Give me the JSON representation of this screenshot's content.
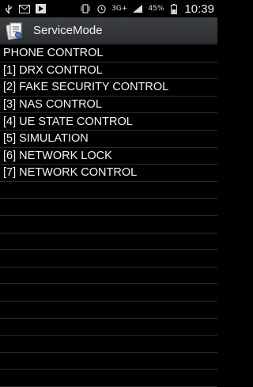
{
  "status_bar": {
    "notification_icons": [
      "usb-icon",
      "email-icon",
      "play-store-icon"
    ],
    "network_type": "3G+",
    "battery_percent": "45%",
    "time": "10:39"
  },
  "action_bar": {
    "title": "ServiceMode"
  },
  "menu": {
    "items": [
      "PHONE CONTROL",
      "[1] DRX CONTROL",
      "[2] FAKE SECURITY CONTROL",
      "[3] NAS CONTROL",
      "[4] UE STATE CONTROL",
      "[5] SIMULATION",
      "[6] NETWORK LOCK",
      "[7] NETWORK CONTROL",
      "",
      "",
      "",
      "",
      "",
      "",
      "",
      "",
      "",
      "",
      "",
      ""
    ]
  },
  "colors": {
    "background": "#000000",
    "action_bar": "#353739",
    "text": "#f4f4f4",
    "divider": "#2b2b2b"
  }
}
